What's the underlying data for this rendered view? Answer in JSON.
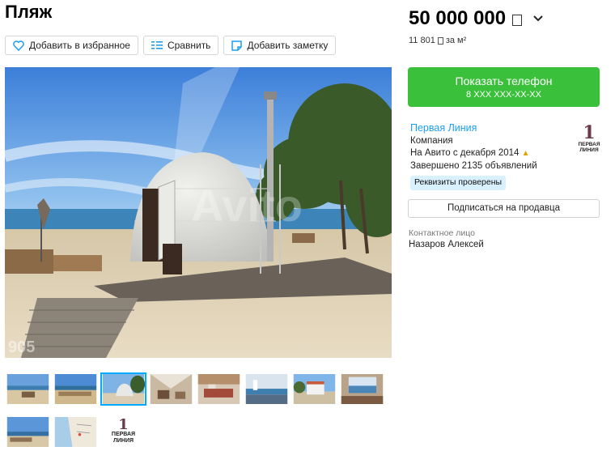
{
  "title": "Пляж",
  "actions": {
    "favorite_label": "Добавить в избранное",
    "compare_label": "Сравнить",
    "note_label": "Добавить заметку"
  },
  "photo": {
    "watermark": "Avito",
    "corner_mark": "905"
  },
  "price": {
    "value": "50 000 000",
    "per_m2_value": "11 801",
    "per_m2_unit": "за м²"
  },
  "phone": {
    "label": "Показать телефон",
    "masked": "8 XXX XXX-XX-XX"
  },
  "seller": {
    "name": "Первая Линия",
    "type": "Компания",
    "since": "На Авито с декабря 2014",
    "completed": "Завершено 2135 объявлений",
    "badge": "Реквизиты проверены",
    "logo_number": "1",
    "logo_text_1": "ПЕРВАЯ",
    "logo_text_2": "ЛИНИЯ"
  },
  "subscribe_label": "Подписаться на продавца",
  "contact": {
    "label": "Контактное лицо",
    "name": "Назаров Алексей"
  },
  "thumb_logo": {
    "number": "1",
    "line1": "ПЕРВАЯ",
    "line2": "ЛИНИЯ"
  },
  "colors": {
    "phone_button": "#3bc03b",
    "link": "#1c9ff0",
    "badge_bg": "#d9f1ff",
    "active_thumb_border": "#00aaff"
  }
}
